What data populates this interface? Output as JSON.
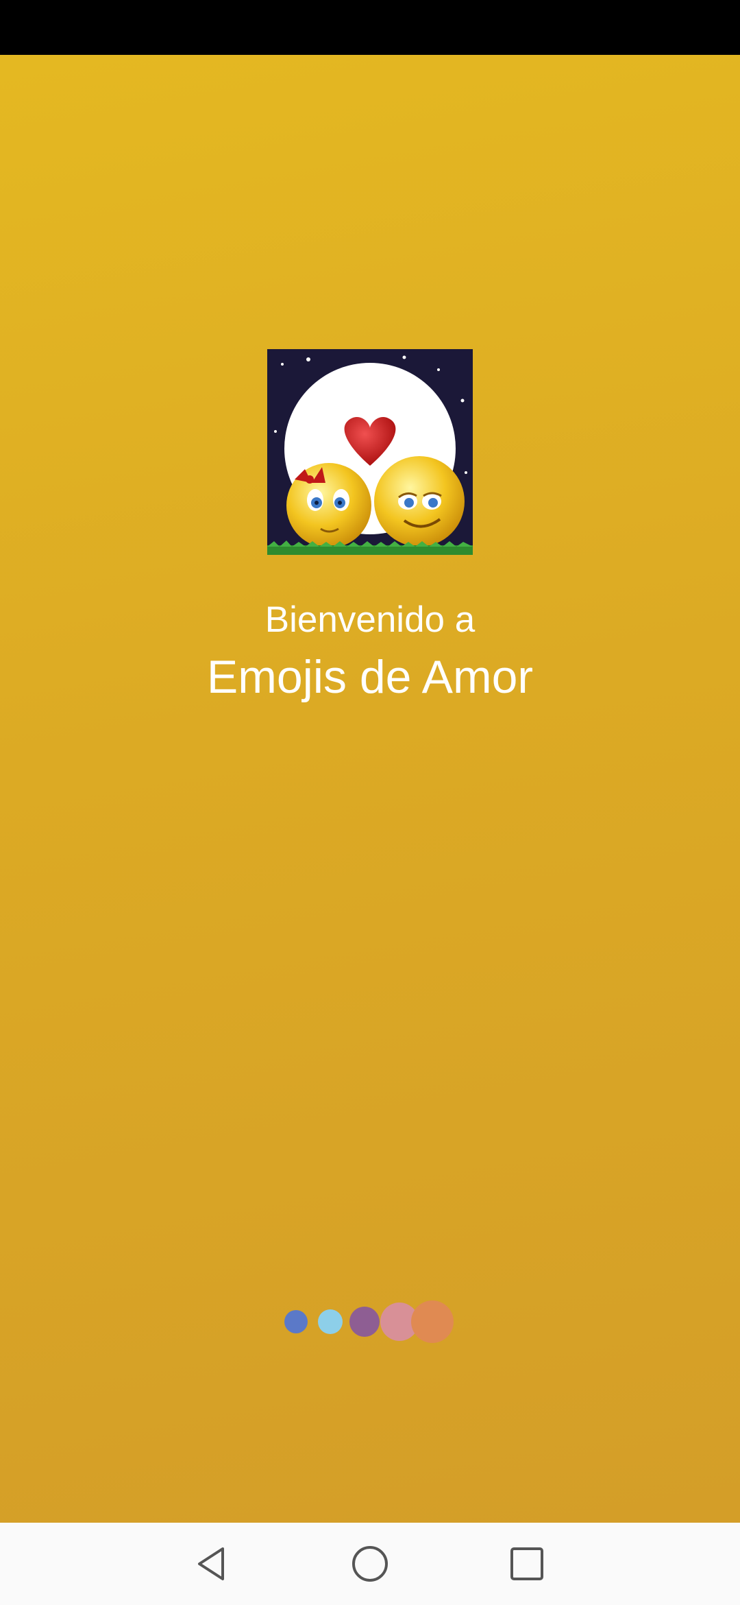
{
  "splash": {
    "welcome_text": "Bienvenido a",
    "app_name": "Emojis de Amor",
    "background_colors": [
      "#E4B822",
      "#DCAA24",
      "#D49E28"
    ],
    "logo": "couple-emoji-heart-moon-logo"
  },
  "loader": {
    "dot_colors": [
      "#5B79C8",
      "#8DCFE9",
      "#8E5E93",
      "#D89097",
      "#E08A52"
    ]
  },
  "nav_bar": {
    "back": "back-icon",
    "home": "home-icon",
    "recents": "recents-icon"
  }
}
